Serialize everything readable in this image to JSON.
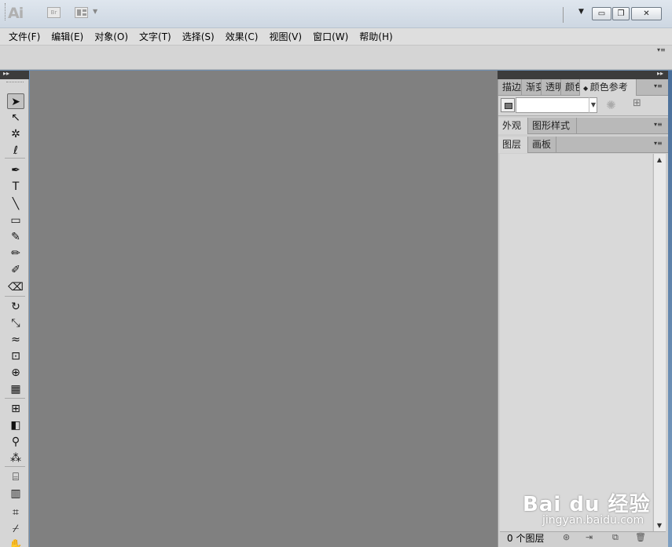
{
  "app": {
    "logo": "Ai",
    "bridge_label": "Br"
  },
  "menubar": {
    "items": [
      "文件(F)",
      "编辑(E)",
      "对象(O)",
      "文字(T)",
      "选择(S)",
      "效果(C)",
      "视图(V)",
      "窗口(W)",
      "帮助(H)"
    ]
  },
  "window_controls": {
    "minimize": "▭",
    "restore": "❐",
    "close": "✕"
  },
  "tools": [
    {
      "name": "selection-tool-icon",
      "glyph": "➤",
      "selected": true
    },
    {
      "name": "direct-selection-tool-icon",
      "glyph": "↖",
      "selected": false
    },
    {
      "name": "magic-wand-tool-icon",
      "glyph": "✲",
      "selected": false
    },
    {
      "name": "lasso-tool-icon",
      "glyph": "ℓ",
      "selected": false
    },
    {
      "name": "pen-tool-icon",
      "glyph": "✒",
      "selected": false
    },
    {
      "name": "type-tool-icon",
      "glyph": "T",
      "selected": false
    },
    {
      "name": "line-segment-tool-icon",
      "glyph": "╲",
      "selected": false
    },
    {
      "name": "rectangle-tool-icon",
      "glyph": "▭",
      "selected": false
    },
    {
      "name": "paintbrush-tool-icon",
      "glyph": "✎",
      "selected": false
    },
    {
      "name": "pencil-tool-icon",
      "glyph": "✏",
      "selected": false
    },
    {
      "name": "blob-brush-tool-icon",
      "glyph": "✐",
      "selected": false
    },
    {
      "name": "eraser-tool-icon",
      "glyph": "⌫",
      "selected": false
    },
    {
      "name": "rotate-tool-icon",
      "glyph": "↻",
      "selected": false
    },
    {
      "name": "scale-tool-icon",
      "glyph": "⤡",
      "selected": false
    },
    {
      "name": "warp-tool-icon",
      "glyph": "≈",
      "selected": false
    },
    {
      "name": "free-transform-tool-icon",
      "glyph": "⊡",
      "selected": false
    },
    {
      "name": "shape-builder-tool-icon",
      "glyph": "⊕",
      "selected": false
    },
    {
      "name": "perspective-grid-tool-icon",
      "glyph": "▦",
      "selected": false
    },
    {
      "name": "mesh-tool-icon",
      "glyph": "⊞",
      "selected": false
    },
    {
      "name": "gradient-tool-icon",
      "glyph": "◧",
      "selected": false
    },
    {
      "name": "eyedropper-tool-icon",
      "glyph": "⚲",
      "selected": false
    },
    {
      "name": "blend-tool-icon",
      "glyph": "⁂",
      "selected": false
    },
    {
      "name": "symbol-sprayer-tool-icon",
      "glyph": "⌸",
      "selected": false
    },
    {
      "name": "column-graph-tool-icon",
      "glyph": "▥",
      "selected": false
    },
    {
      "name": "artboard-tool-icon",
      "glyph": "⌗",
      "selected": false
    },
    {
      "name": "slice-tool-icon",
      "glyph": "⌿",
      "selected": false
    },
    {
      "name": "hand-tool-icon",
      "glyph": "✋",
      "selected": false
    }
  ],
  "panels": {
    "group1_tabs": [
      "描边",
      "渐变",
      "透明",
      "颜色",
      "颜色参考"
    ],
    "group2_tabs": [
      "外观",
      "图形样式"
    ],
    "group3_tabs": [
      "图层",
      "画板"
    ],
    "layers_footer": {
      "count_label": "0 个图层"
    }
  },
  "watermark": {
    "text": "Bai du 经验",
    "sub": "jingyan.baidu.com"
  }
}
